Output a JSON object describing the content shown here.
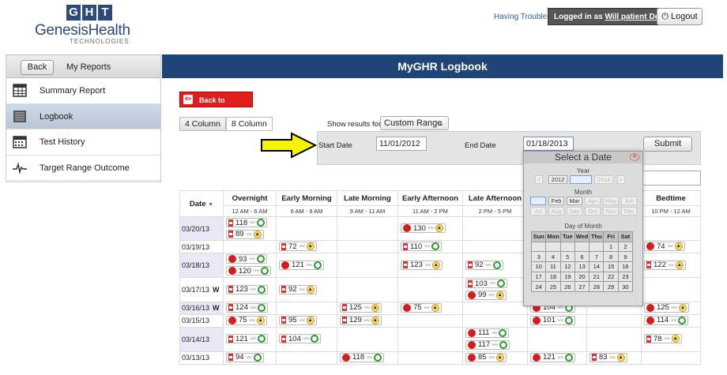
{
  "header": {
    "logo_letters": [
      "G",
      "H",
      "T"
    ],
    "logo_name": "GenesisHealth",
    "logo_sub": "TECHNOLOGIES",
    "trouble": "Having Trouble?",
    "logged_prefix": "Logged in as",
    "logged_user": "Will patient Demo",
    "logout": "Logout"
  },
  "sidebar": {
    "back": "Back",
    "my_reports": "My Reports",
    "items": [
      {
        "label": "Summary Report",
        "icon": "table-icon"
      },
      {
        "label": "Logbook",
        "icon": "list-icon",
        "active": true
      },
      {
        "label": "Test History",
        "icon": "calendar-icon"
      },
      {
        "label": "Target Range Outcome",
        "icon": "pulse-icon"
      }
    ]
  },
  "main": {
    "title": "MyGHR Logbook",
    "back_to_reports": "Back to Reports",
    "col4": "4 Column",
    "col8": "8 Column",
    "show_for": "Show results for:",
    "range": "Custom Range",
    "start_label": "Start Date",
    "start_value": "11/01/2012",
    "end_label": "End Date",
    "end_value": "01/18/2013",
    "submit": "Submit"
  },
  "table": {
    "date_header": "Date",
    "columns": [
      {
        "name": "Overnight",
        "time": "12 AM - 6 AM"
      },
      {
        "name": "Early Morning",
        "time": "6 AM - 9 AM"
      },
      {
        "name": "Late Morning",
        "time": "9 AM - 11 AM"
      },
      {
        "name": "Early Afternoon",
        "time": "11 AM - 2 PM"
      },
      {
        "name": "Late Afternoon",
        "time": "2 PM - 5 PM"
      },
      {
        "name": "",
        "time": ""
      },
      {
        "name": "",
        "time": ""
      },
      {
        "name": "Bedtime",
        "time": "10 PM - 12 AM"
      }
    ],
    "rows": [
      {
        "date": "03/20/13",
        "cells": [
          [
            [
              "hg",
              "118",
              "gc"
            ],
            [
              "hg",
              "89",
              "oc"
            ]
          ],
          [],
          [],
          [
            [
              "ap",
              "130",
              "oc"
            ]
          ],
          [],
          [],
          [],
          []
        ]
      },
      {
        "date": "03/19/13",
        "cells": [
          [],
          [
            [
              "hg",
              "72",
              "oc"
            ]
          ],
          [],
          [
            [
              "hg",
              "110",
              "gc"
            ]
          ],
          [],
          [],
          [],
          [
            [
              "ap",
              "74",
              "oc"
            ]
          ]
        ]
      },
      {
        "date": "03/18/13",
        "cells": [
          [
            [
              "ap",
              "93",
              "gc"
            ],
            [
              "ap",
              "120",
              "gc"
            ]
          ],
          [
            [
              "ap",
              "121",
              "gc"
            ]
          ],
          [],
          [
            [
              "hg",
              "123",
              "oc"
            ]
          ],
          [
            [
              "hg",
              "92",
              "gc"
            ]
          ],
          [],
          [],
          [
            [
              "hg",
              "122",
              "oc"
            ]
          ]
        ]
      },
      {
        "date": "03/17/13",
        "weekend": "W",
        "cells": [
          [
            [
              "hg",
              "123",
              "gc"
            ]
          ],
          [
            [
              "hg",
              "92",
              "oc"
            ]
          ],
          [],
          [],
          [
            [
              "hg",
              "103",
              "gc"
            ],
            [
              "ap",
              "99",
              "oc"
            ]
          ],
          [],
          [],
          []
        ]
      },
      {
        "date": "03/16/13",
        "weekend": "W",
        "cells": [
          [
            [
              "hg",
              "124",
              "gc"
            ]
          ],
          [],
          [
            [
              "hg",
              "125",
              "oc"
            ]
          ],
          [
            [
              "ap",
              "75",
              "oc"
            ]
          ],
          [],
          [
            [
              "ap",
              "104",
              "gc"
            ]
          ],
          [],
          [
            [
              "ap",
              "125",
              "oc"
            ]
          ]
        ]
      },
      {
        "date": "03/15/13",
        "cells": [
          [
            [
              "ap",
              "75",
              "oc"
            ]
          ],
          [
            [
              "hg",
              "95",
              "oc"
            ]
          ],
          [
            [
              "hg",
              "129",
              "oc"
            ]
          ],
          [],
          [],
          [
            [
              "ap",
              "101",
              "gc"
            ]
          ],
          [],
          [
            [
              "ap",
              "114",
              "gc"
            ]
          ]
        ]
      },
      {
        "date": "03/14/13",
        "cells": [
          [
            [
              "hg",
              "121",
              "gc"
            ]
          ],
          [
            [
              "hg",
              "104",
              "gc"
            ]
          ],
          [],
          [],
          [
            [
              "ap",
              "111",
              "gc"
            ],
            [
              "ap",
              "117",
              "gc"
            ]
          ],
          [],
          [],
          [
            [
              "hg",
              "78",
              "oc"
            ]
          ]
        ]
      },
      {
        "date": "03/13/13",
        "cells": [
          [
            [
              "hg",
              "94",
              "gc"
            ]
          ],
          [],
          [
            [
              "ap",
              "118",
              "gc"
            ]
          ],
          [],
          [
            [
              "ap",
              "85",
              "oc"
            ]
          ],
          [
            [
              "ap",
              "121",
              "gc"
            ]
          ],
          [
            [
              "hg",
              "83",
              "oc"
            ]
          ],
          []
        ]
      }
    ]
  },
  "datepicker": {
    "title": "Select a Date",
    "year_label": "Year",
    "years": [
      "2012",
      "2013",
      "2014"
    ],
    "month_label": "Month",
    "months": [
      "Jan",
      "Feb",
      "Mar",
      "Apr",
      "May",
      "Jun",
      "Jul",
      "Aug",
      "Sep",
      "Oct",
      "Nov",
      "Dec"
    ],
    "day_label": "Day of Month",
    "weekdays": [
      "Sun",
      "Mon",
      "Tue",
      "Wed",
      "Thu",
      "Fri",
      "Sat"
    ],
    "weeks": [
      [
        "",
        "",
        "",
        "",
        "",
        "1",
        "2"
      ],
      [
        "3",
        "4",
        "5",
        "6",
        "7",
        "8",
        "9"
      ],
      [
        "10",
        "11",
        "12",
        "13",
        "14",
        "15",
        "16"
      ],
      [
        "17",
        "18",
        "19",
        "20",
        "21",
        "22",
        "23"
      ],
      [
        "24",
        "25",
        "26",
        "27",
        "28",
        "29",
        "30"
      ],
      [
        "",
        "",
        "",
        "",
        "",
        "",
        ""
      ]
    ]
  }
}
